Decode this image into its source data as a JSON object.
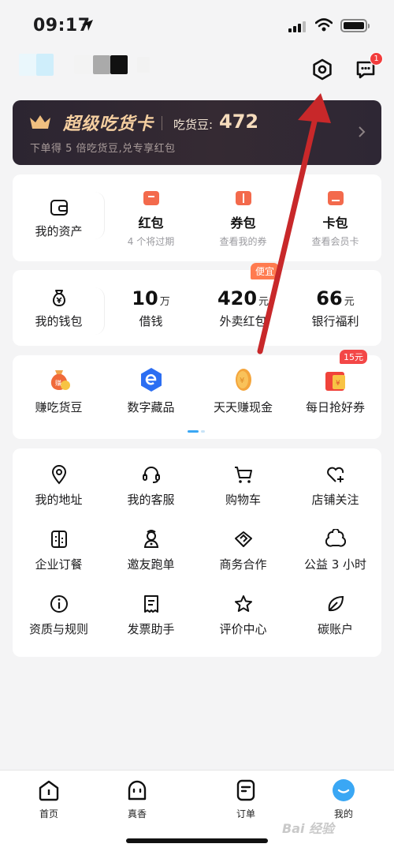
{
  "status_bar": {
    "time": "09:17"
  },
  "header": {
    "message_badge": "1"
  },
  "vip_card": {
    "title": "超级吃货卡",
    "beans_label": "吃货豆:",
    "beans_value": "472",
    "subtitle": "下单得 5 倍吃货豆,兑专享红包"
  },
  "assets": {
    "title": "我的资产",
    "items": [
      {
        "label": "红包",
        "sub": "4 个将过期"
      },
      {
        "label": "券包",
        "sub": "查看我的券"
      },
      {
        "label": "卡包",
        "sub": "查看会员卡"
      }
    ]
  },
  "wallet": {
    "title": "我的钱包",
    "items": [
      {
        "value": "10",
        "unit": "万",
        "label": "借钱"
      },
      {
        "value": "420",
        "unit": "元",
        "label": "外卖红包",
        "tag": "便宜"
      },
      {
        "value": "66",
        "unit": "元",
        "label": "银行福利"
      }
    ]
  },
  "promos": {
    "items": [
      {
        "label": "赚吃货豆"
      },
      {
        "label": "数字藏品"
      },
      {
        "label": "天天赚现金"
      },
      {
        "label": "每日抢好券",
        "tag": "15元"
      }
    ]
  },
  "services": {
    "items": [
      {
        "label": "我的地址",
        "icon": "location-icon"
      },
      {
        "label": "我的客服",
        "icon": "headset-icon"
      },
      {
        "label": "购物车",
        "icon": "cart-icon"
      },
      {
        "label": "店铺关注",
        "icon": "heart-plus-icon"
      },
      {
        "label": "企业订餐",
        "icon": "enterprise-icon"
      },
      {
        "label": "邀友跑单",
        "icon": "rider-icon"
      },
      {
        "label": "商务合作",
        "icon": "handshake-icon"
      },
      {
        "label": "公益 3 小时",
        "icon": "charity-icon"
      },
      {
        "label": "资质与规则",
        "icon": "info-icon"
      },
      {
        "label": "发票助手",
        "icon": "invoice-icon"
      },
      {
        "label": "评价中心",
        "icon": "star-icon"
      },
      {
        "label": "碳账户",
        "icon": "leaf-icon"
      }
    ]
  },
  "tabbar": {
    "items": [
      {
        "label": "首页",
        "icon": "home-icon"
      },
      {
        "label": "真香",
        "icon": "zhenxiang-icon"
      },
      {
        "label": "订单",
        "icon": "order-icon"
      },
      {
        "label": "我的",
        "icon": "profile-icon",
        "active": true
      }
    ]
  },
  "watermark": "Bai 经验",
  "colors": {
    "accent_blue": "#3aa7f4",
    "vip_gold": "#f5cfa0",
    "annotation_red": "#c8282a",
    "badge_red": "#f23c3c"
  }
}
